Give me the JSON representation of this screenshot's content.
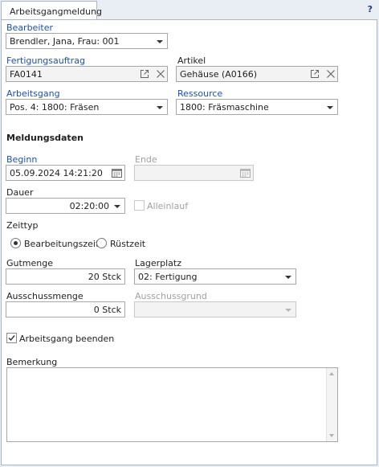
{
  "tab": {
    "label": "Arbeitsgangmeldung",
    "help": "?"
  },
  "bearbeiter": {
    "label": "Bearbeiter",
    "value": "Brendler, Jana, Frau: 001"
  },
  "fertigungsauftrag": {
    "label": "Fertigungsauftrag",
    "value": "FA0141"
  },
  "artikel": {
    "label": "Artikel",
    "value": "Gehäuse (A0166)"
  },
  "arbeitsgang": {
    "label": "Arbeitsgang",
    "value": "Pos. 4: 1800: Fräsen"
  },
  "ressource": {
    "label": "Ressource",
    "value": "1800: Fräsmaschine"
  },
  "meldungsdaten": {
    "title": "Meldungsdaten"
  },
  "beginn": {
    "label": "Beginn",
    "value": "05.09.2024 14:21:20"
  },
  "ende": {
    "label": "Ende",
    "value": ""
  },
  "dauer": {
    "label": "Dauer",
    "value": "02:20:00"
  },
  "alleinlauf": {
    "label": "Alleinlauf",
    "checked": false
  },
  "zeittyp": {
    "label": "Zeittyp",
    "option1": "Bearbeitungszeit",
    "option2": "Rüstzeit",
    "selected": "Bearbeitungszeit"
  },
  "gutmenge": {
    "label": "Gutmenge",
    "value": "20 Stck"
  },
  "lagerplatz": {
    "label": "Lagerplatz",
    "value": "02: Fertigung"
  },
  "ausschussmenge": {
    "label": "Ausschussmenge",
    "value": "0 Stck"
  },
  "ausschussgrund": {
    "label": "Ausschussgrund",
    "value": ""
  },
  "arbeitsgang_beenden": {
    "label": "Arbeitsgang beenden",
    "checked": true
  },
  "bemerkung": {
    "label": "Bemerkung",
    "value": ""
  },
  "colors": {
    "required_label": "#1a4fbf",
    "disabled_label": "#a0a0a0",
    "panel_border": "#a9b7c8",
    "background": "#e9eef4"
  }
}
